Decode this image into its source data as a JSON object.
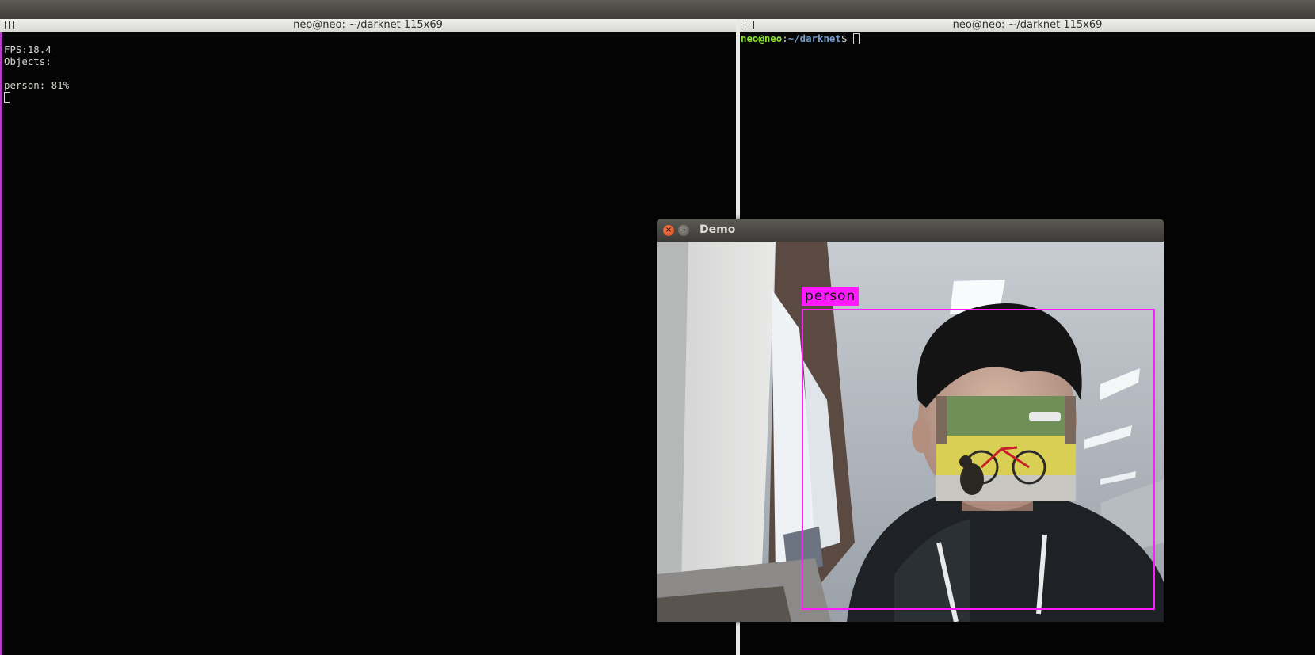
{
  "left_terminal": {
    "title": "neo@neo: ~/darknet 115x69",
    "lines": [
      "FPS:18.4",
      "Objects:",
      "",
      "person: 81%"
    ]
  },
  "right_terminal": {
    "title": "neo@neo: ~/darknet 115x69",
    "prompt_user": "neo@neo",
    "prompt_sep": ":",
    "prompt_path": "~/darknet",
    "prompt_symbol": "$ "
  },
  "demo_window": {
    "title": "Demo",
    "close_glyph": "×",
    "minimize_glyph": "–",
    "detection_label": "person",
    "bbox_color": "#ff1aff"
  }
}
